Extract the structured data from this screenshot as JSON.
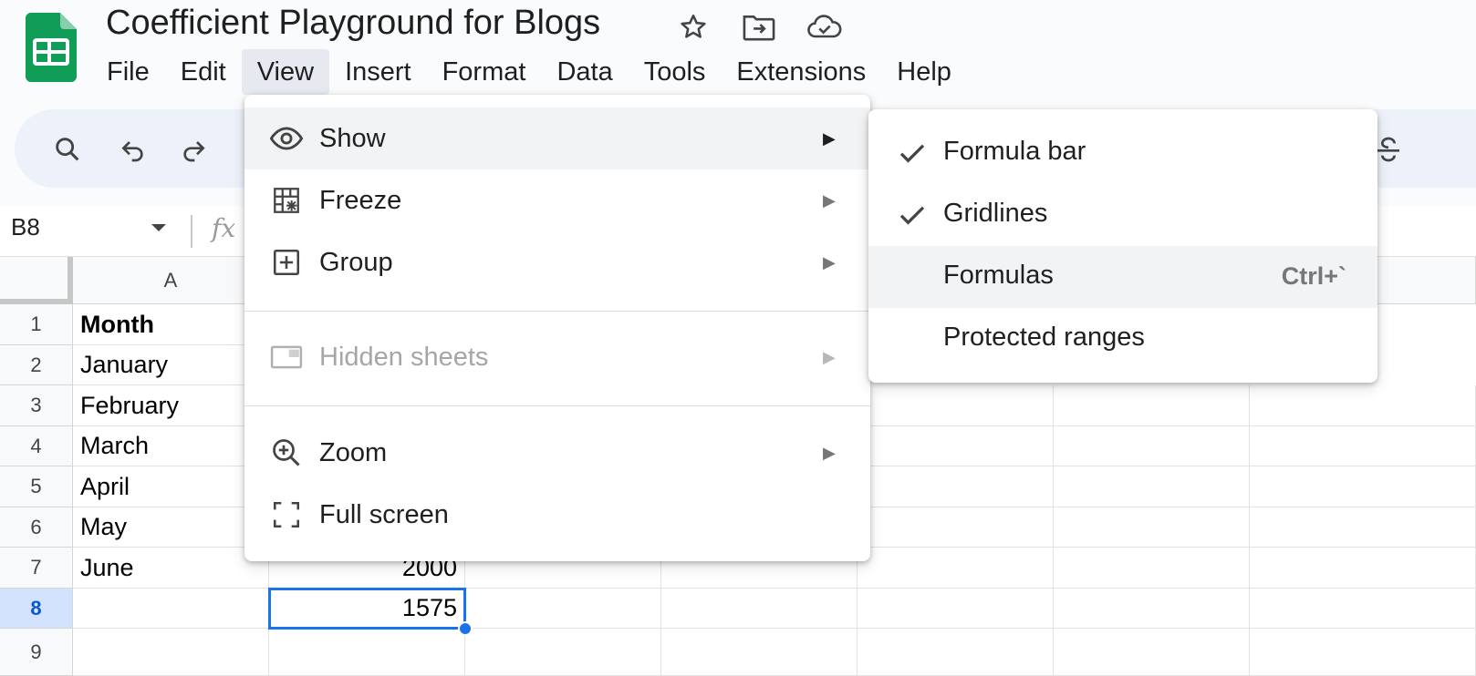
{
  "header": {
    "title": "Coefficient Playground for Blogs",
    "icons": [
      "star-icon",
      "move-folder-icon",
      "cloud-saved-icon"
    ]
  },
  "menubar": {
    "items": [
      "File",
      "Edit",
      "View",
      "Insert",
      "Format",
      "Data",
      "Tools",
      "Extensions",
      "Help"
    ],
    "active": "View"
  },
  "toolbar": {
    "icons": [
      "search-icon",
      "undo-icon",
      "redo-icon",
      "strikethrough-icon"
    ]
  },
  "formula_bar": {
    "cell_ref": "B8",
    "fx": "fx"
  },
  "grid": {
    "columns": [
      "A",
      "",
      "",
      "",
      "",
      "",
      ""
    ],
    "rows": [
      "1",
      "2",
      "3",
      "4",
      "5",
      "6",
      "7",
      "8",
      "9"
    ],
    "selected_row": "8",
    "column_a": [
      "Month",
      "January",
      "February",
      "March",
      "April",
      "May",
      "June",
      "",
      ""
    ],
    "column_b_visible": {
      "7": "2000",
      "8": "1575"
    },
    "selected_cell": "B8"
  },
  "view_menu": {
    "items": [
      {
        "label": "Show",
        "icon": "eye-icon",
        "submenu": true,
        "highlighted": true
      },
      {
        "label": "Freeze",
        "icon": "freeze-icon",
        "submenu": true
      },
      {
        "label": "Group",
        "icon": "group-icon",
        "submenu": true
      },
      {
        "label": "Hidden sheets",
        "icon": "hidden-sheets-icon",
        "submenu": true,
        "disabled": true
      },
      {
        "label": "Zoom",
        "icon": "zoom-icon",
        "submenu": true
      },
      {
        "label": "Full screen",
        "icon": "fullscreen-icon",
        "submenu": false
      }
    ]
  },
  "show_submenu": {
    "items": [
      {
        "label": "Formula bar",
        "checked": true,
        "shortcut": ""
      },
      {
        "label": "Gridlines",
        "checked": true,
        "shortcut": ""
      },
      {
        "label": "Formulas",
        "checked": false,
        "shortcut": "Ctrl+`",
        "highlighted": true
      },
      {
        "label": "Protected ranges",
        "checked": false,
        "shortcut": ""
      }
    ]
  },
  "colors": {
    "sheets_green": "#0f9d58",
    "selection_blue": "#1a73e8",
    "toolbar_bg": "#edf2fa",
    "menu_hover": "#f1f3f4"
  }
}
